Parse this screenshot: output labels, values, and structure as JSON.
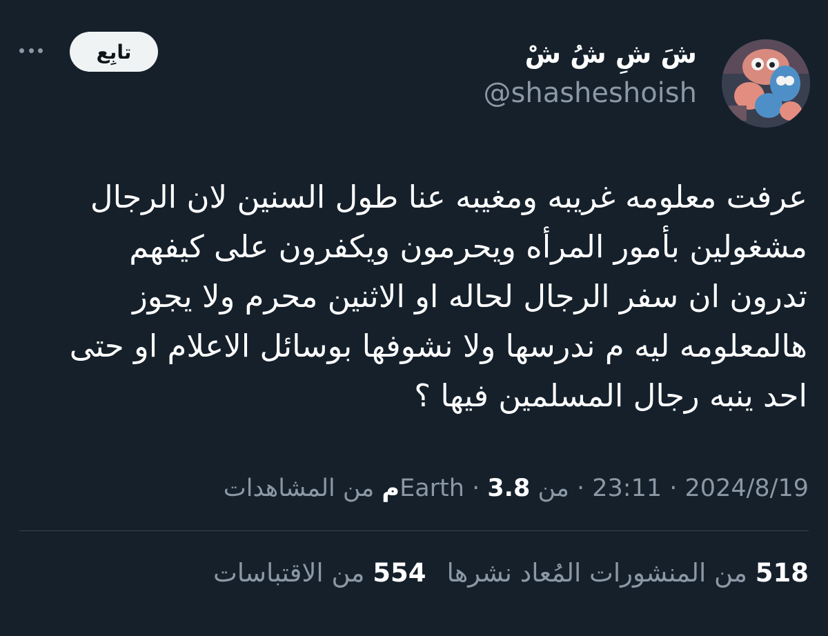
{
  "author": {
    "display_name": "شَ شِ شُ شْ",
    "handle": "@shasheshoish",
    "avatar_icon": "cartoon-avatar"
  },
  "actions": {
    "follow_label": "تابِع",
    "more_icon": "more-horizontal-icon"
  },
  "tweet": {
    "text": "عرفت معلومه غريبه ومغيبه عنا طول السنين لان الرجال\nمشغولين بأمور المرأه ويحرمون ويكفرون على كيفهم\nتدرون ان سفر الرجال لحاله او الاثنين محرم ولا يجوز\nهالمعلومه ليه م ندرسها ولا نشوفها بوسائل الاعلام او حتى\nاحد ينبه رجال المسلمين فيها ؟"
  },
  "meta": {
    "date": "2024/8/19",
    "separator": " · ",
    "time": "23:11",
    "source": "من Earth",
    "views_count": "3.8م",
    "views_label": " من المشاهدات"
  },
  "stats": {
    "reposts_count": "518",
    "reposts_label": " من المنشورات المُعاد نشرها",
    "quotes_count": "554",
    "quotes_label": " من الاقتباسات"
  },
  "colors": {
    "background": "#15202b",
    "text": "#ffffff",
    "secondary_text": "#8b98a5",
    "divider": "#38444d",
    "follow_bg": "#eff3f4"
  }
}
